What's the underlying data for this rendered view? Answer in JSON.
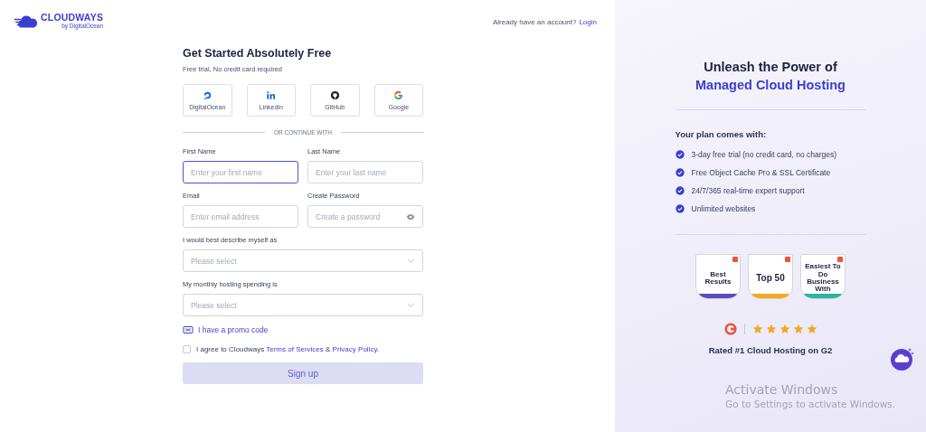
{
  "logo": {
    "brand": "CLOUDWAYS",
    "byline": "by DigitalOcean"
  },
  "header": {
    "prompt": "Already have an account?",
    "link": "Login"
  },
  "form": {
    "title": "Get Started Absolutely Free",
    "subtitle": "Free trial, No credit card required",
    "social": [
      {
        "kind": "digitalocean",
        "label": "DigitalOcean"
      },
      {
        "kind": "linkedin",
        "label": "Linkedin"
      },
      {
        "kind": "github",
        "label": "GitHub"
      },
      {
        "kind": "google",
        "label": "Google"
      }
    ],
    "divider_text": "OR CONTINUE WITH",
    "fields": [
      {
        "kind": "text",
        "label": "First Name",
        "placeholder": "Enter your first name",
        "focused": true
      },
      {
        "kind": "text",
        "label": "Last Name",
        "placeholder": "Enter your last name",
        "focused": false
      },
      {
        "kind": "text",
        "label": "Email",
        "placeholder": "Enter email address",
        "focused": false
      },
      {
        "kind": "password",
        "label": "Create Password",
        "placeholder": "Create a password",
        "focused": false
      },
      {
        "kind": "select",
        "label": "I would best describe myself as",
        "placeholder": "Please select",
        "focused": false
      },
      {
        "kind": "select",
        "label": "My monthly hosting spending is",
        "placeholder": "Please select",
        "focused": false
      }
    ],
    "promo_link": "I have a promo code",
    "agreement": {
      "checked": false,
      "prefix": "I agree to Cloudways",
      "terms": "Terms of Services",
      "joiner": "&",
      "privacy": "Privacy Policy."
    },
    "submit": {
      "label": "Sign up",
      "disabled": true
    }
  },
  "panel": {
    "heading": "Unleash the Power of",
    "highlight": "Managed Cloud Hosting",
    "plan_title": "Your plan comes with:",
    "features": [
      "3-day free trial (no credit card, no charges)",
      "Free Object Cache Pro & SSL Certificate",
      "24/7/365 real-time expert support",
      "Unlimited websites"
    ],
    "badges": [
      {
        "title": "Best Results",
        "color": "#5a4cc0"
      },
      {
        "title": "Top 50",
        "color": "#f5a623"
      },
      {
        "title": "Easiest To Do Business With",
        "color": "#2bb5a0"
      }
    ],
    "rating": {
      "stars": 5,
      "caption": "Rated #1 Cloud Hosting on G2"
    }
  },
  "os_notice": {
    "title": "Activate Windows",
    "message": "Go to Settings to activate Windows."
  }
}
